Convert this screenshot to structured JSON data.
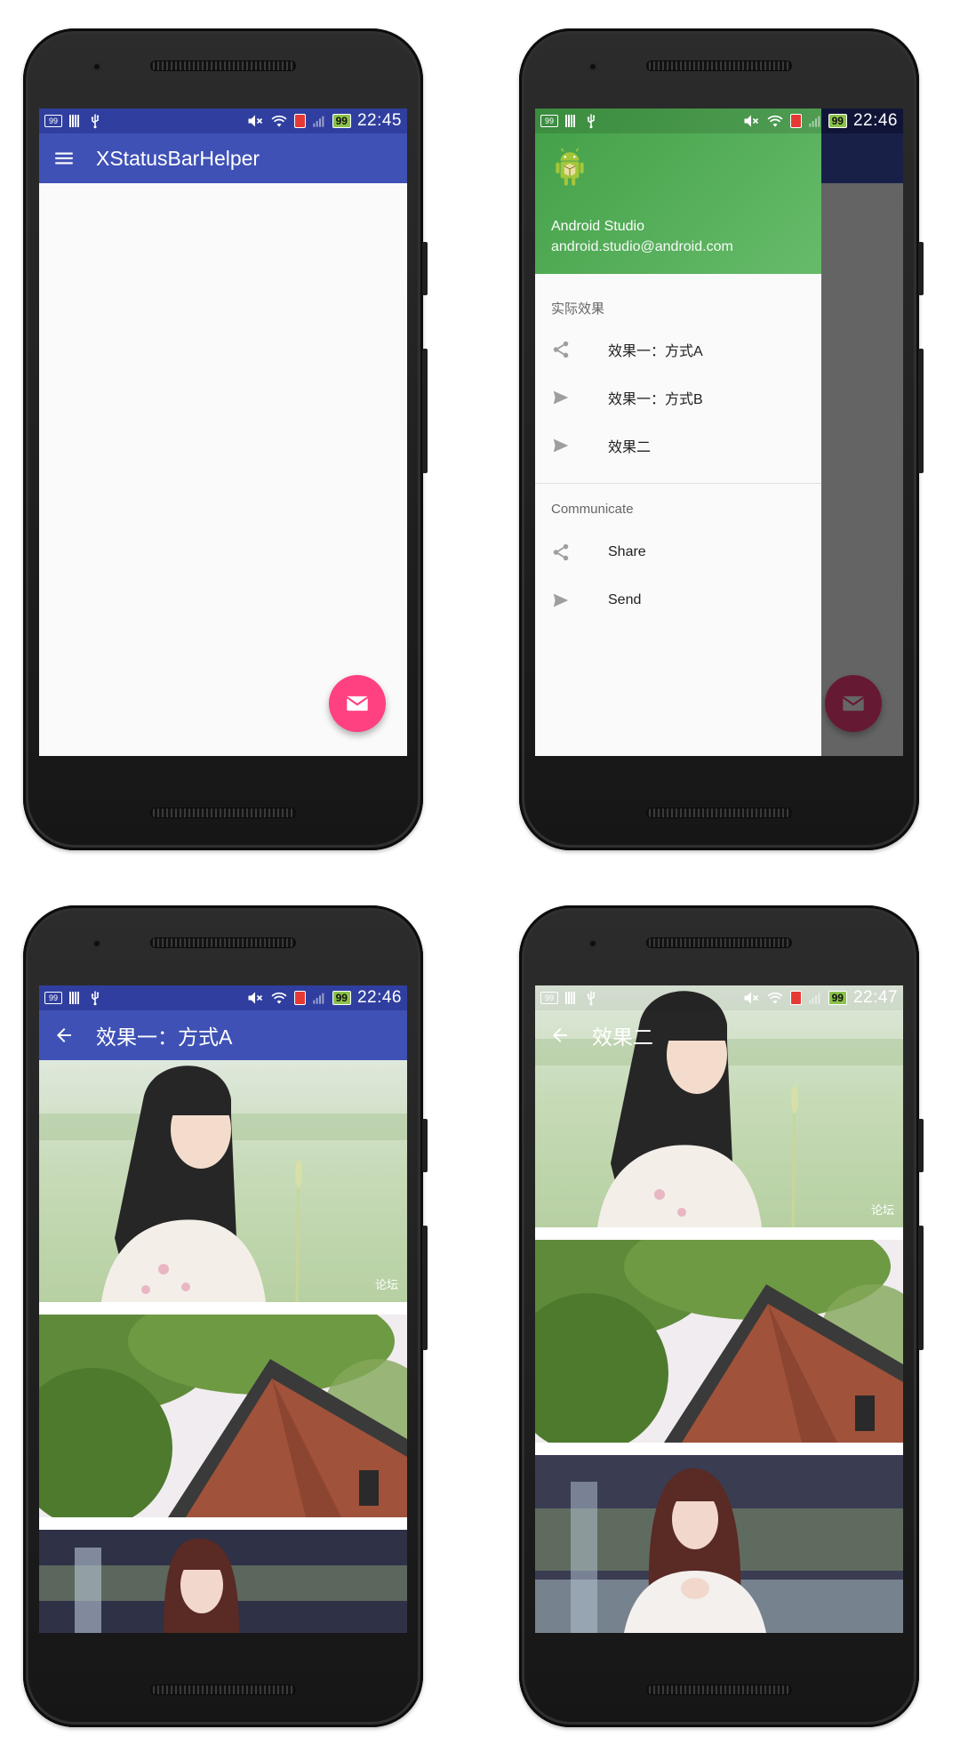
{
  "colors": {
    "primary": "#3f51b5",
    "primary_dark": "#303f9f",
    "accent": "#ff4081",
    "drawer_header": "#4caf50"
  },
  "status": {
    "notif_badge": "99",
    "battery": "99"
  },
  "screen1": {
    "time": "22:45",
    "title": "XStatusBarHelper",
    "nav_icon": "menu-icon",
    "fab_icon": "mail-icon"
  },
  "screen2": {
    "time": "22:46",
    "drawer": {
      "name": "Android Studio",
      "email": "android.studio@android.com",
      "section1": "实际效果",
      "items1": [
        {
          "label": "效果一：方式A",
          "icon": "share-icon"
        },
        {
          "label": "效果一：方式B",
          "icon": "send-icon"
        },
        {
          "label": "效果二",
          "icon": "send-icon"
        }
      ],
      "section2": "Communicate",
      "items2": [
        {
          "label": "Share",
          "icon": "share-icon"
        },
        {
          "label": "Send",
          "icon": "send-icon"
        }
      ]
    }
  },
  "screen3": {
    "time": "22:46",
    "title": "效果一：方式A",
    "nav_icon": "arrow-back-icon",
    "watermark": "论坛"
  },
  "screen4": {
    "time": "22:47",
    "title": "效果二",
    "nav_icon": "arrow-back-icon",
    "watermark": "论坛"
  }
}
